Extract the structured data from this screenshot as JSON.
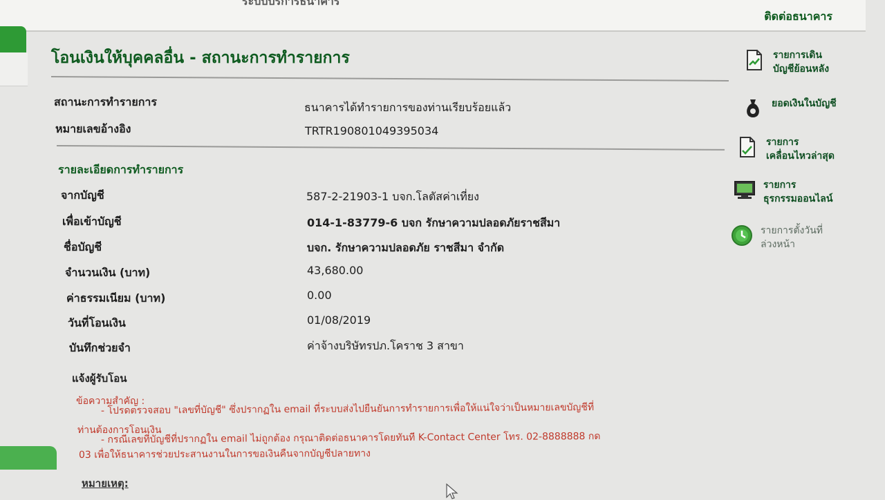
{
  "header": {
    "partial_title": "ระบบบริการธนาคาร",
    "contact_label": "ติดต่อธนาคาร"
  },
  "page": {
    "title": "โอนเงินให้บุคคลอื่น - สถานะการทำรายการ"
  },
  "status": {
    "label": "สถานะการทำรายการ",
    "value": "ธนาคารได้ทำรายการของท่านเรียบร้อยแล้ว"
  },
  "reference": {
    "label": "หมายเลขอ้างอิง",
    "value": "TRTR190801049395034"
  },
  "details": {
    "title": "รายละเอียดการทำรายการ",
    "from_account": {
      "label": "จากบัญชี",
      "value": "587-2-21903-1 บจก.โลตัสค่าเที่ยง"
    },
    "to_account": {
      "label": "เพื่อเข้าบัญชี",
      "value": "014-1-83779-6 บจก รักษาความปลอดภัยราชสีมา"
    },
    "account_name": {
      "label": "ชื่อบัญชี",
      "value": "บจก. รักษาความปลอดภัย ราชสีมา จำกัด"
    },
    "amount": {
      "label": "จำนวนเงิน (บาท)",
      "value": "43,680.00"
    },
    "fee": {
      "label": "ค่าธรรมเนียม (บาท)",
      "value": "0.00"
    },
    "transfer_date": {
      "label": "วันที่โอนเงิน",
      "value": "01/08/2019"
    },
    "memo": {
      "label": "บันทึกช่วยจำ",
      "value": "ค่าจ้างบริษัทรปภ.โคราช 3 สาขา"
    },
    "notify_label": "แจ้งผู้รับโอน"
  },
  "notice": {
    "heading": "ข้อความสำคัญ :",
    "line1": "- โปรดตรวจสอบ \"เลขที่บัญชี\" ซึ่งปรากฏใน email ที่ระบบส่งไปยืนยันการทำรายการเพื่อให้แน่ใจว่าเป็นหมายเลขบัญชีที่",
    "line2": "ท่านต้องการโอนเงิน",
    "line3": "- กรณีเลขที่บัญชีที่ปรากฏใน email ไม่ถูกต้อง กรุณาติดต่อธนาคารโดยทันที K-Contact Center โทร. 02-8888888 กด",
    "line4": "03 เพื่อให้ธนาคารช่วยประสานงานในการขอเงินคืนจากบัญชีปลายทาง"
  },
  "remark": "หมายเหตุ:",
  "sidebar": {
    "items": [
      {
        "label_line1": "รายการเดิน",
        "label_line2": "บัญชีย้อนหลัง",
        "icon": "document-chart-icon"
      },
      {
        "label_line1": "ยอดเงินในบัญชี",
        "label_line2": "",
        "icon": "money-bag-icon"
      },
      {
        "label_line1": "รายการ",
        "label_line2": "เคลื่อนไหวล่าสุด",
        "icon": "document-check-icon"
      },
      {
        "label_line1": "รายการ",
        "label_line2": "ธุรกรรมออนไลน์",
        "icon": "computer-icon"
      },
      {
        "label_line1": "รายการตั้งวันที่",
        "label_line2": "ล่วงหน้า",
        "icon": "clock-icon"
      }
    ]
  },
  "colors": {
    "brand_green": "#0f5b20",
    "accent_green": "#2e9a35",
    "notice_red": "#c0392b"
  }
}
